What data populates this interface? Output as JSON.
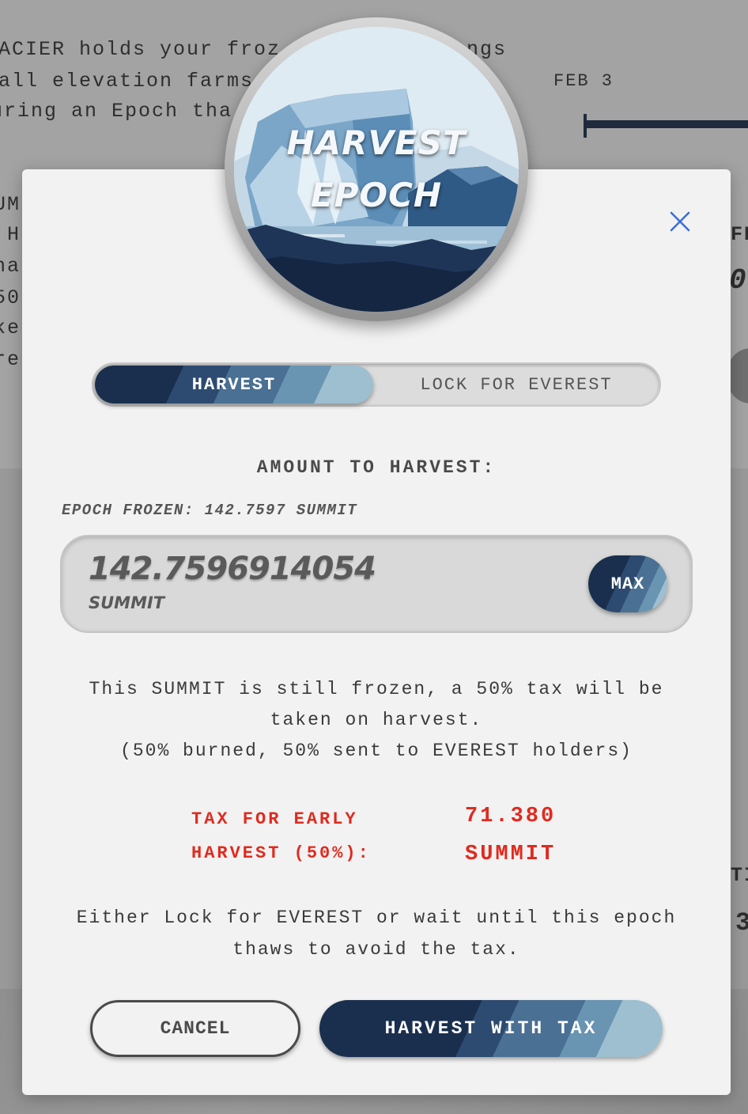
{
  "background": {
    "intro_lines": [
      "ACIER holds your froz",
      "all elevation farms",
      "uring an Epoch tha"
    ],
    "intro_tail": "ngs",
    "date_label": "FEB 3",
    "left_fragments": [
      "UM",
      " H",
      "ha",
      "50",
      "ke",
      "re"
    ],
    "right_fragments": [
      "FR",
      "0",
      "TI",
      "3"
    ]
  },
  "modal": {
    "badge": {
      "title_line1": "HARVEST",
      "title_line2": "EPOCH"
    },
    "tabs": {
      "harvest": "HARVEST",
      "lock": "LOCK FOR EVEREST",
      "active": "harvest"
    },
    "amount_label": "AMOUNT TO HARVEST:",
    "epoch_frozen": "EPOCH FROZEN: 142.7597 SUMMIT",
    "input": {
      "value": "142.7596914054",
      "unit": "SUMMIT",
      "max_label": "MAX"
    },
    "info_line1": "This SUMMIT is still frozen, a 50% tax will be taken on harvest.",
    "info_line2": "(50% burned, 50% sent to EVEREST holders)",
    "tax": {
      "label": "TAX FOR EARLY HARVEST (50%):",
      "value": "71.380",
      "unit": "SUMMIT"
    },
    "avoid_text": "Either Lock for EVEREST or wait until this epoch thaws to avoid the tax.",
    "buttons": {
      "cancel": "CANCEL",
      "confirm": "HARVEST WITH TAX"
    }
  },
  "colors": {
    "accent_dark": "#1a2f4e",
    "accent_light": "#9dbfd0",
    "tax_red": "#e02a1f",
    "close_blue": "#3b6fd8"
  },
  "icons": {
    "close": "close-icon"
  }
}
